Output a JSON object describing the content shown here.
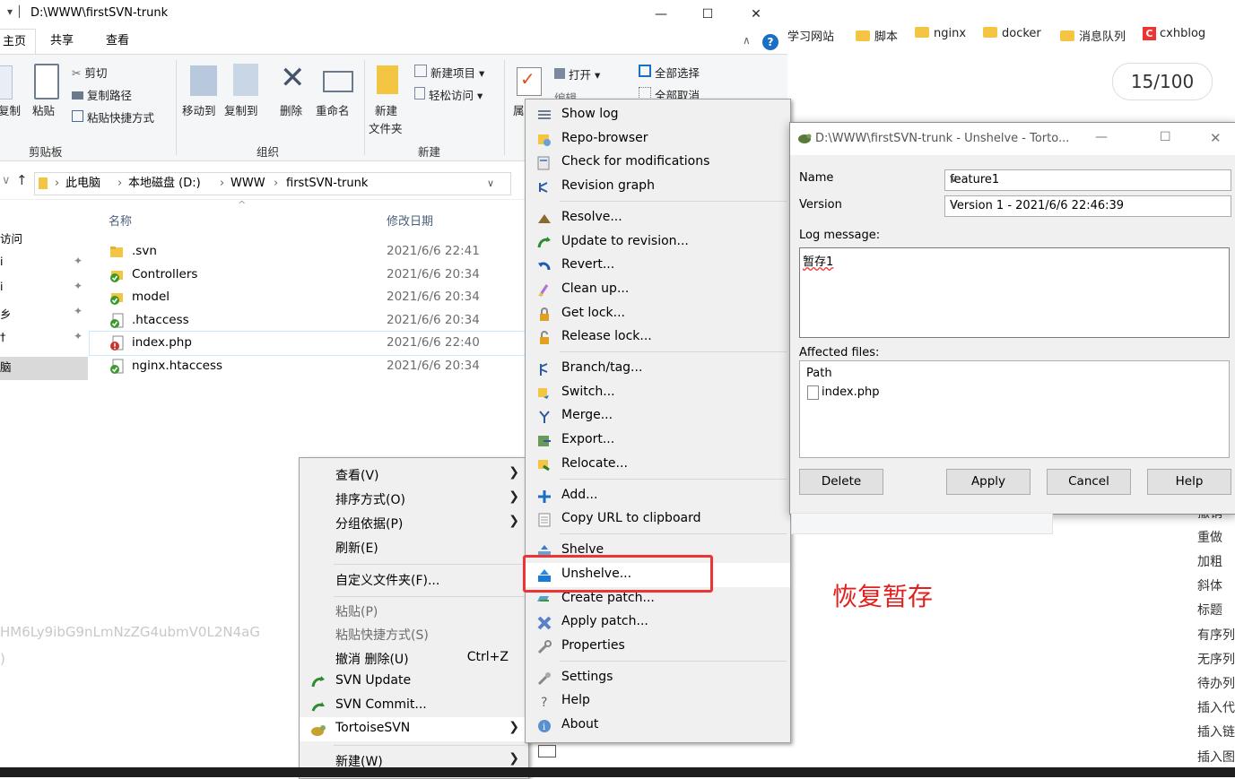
{
  "explorer": {
    "title_path": "D:\\WWW\\firstSVN-trunk",
    "tabs": [
      "主页",
      "共享",
      "查看"
    ],
    "ribbon": {
      "cut": "剪切",
      "copy_path": "复制路径",
      "paste_shortcut": "粘贴快捷方式",
      "copy": "复制",
      "paste": "粘贴",
      "group_clipboard": "剪贴板",
      "move_to": "移动到",
      "copy_to": "复制到",
      "delete": "删除",
      "rename": "重命名",
      "group_organize": "组织",
      "new_folder_1": "新建",
      "new_folder_2": "文件夹",
      "new_item": "新建项目 ▾",
      "easy_access": "轻松访问 ▾",
      "group_new": "新建",
      "open": "打开 ▾",
      "edit": "编辑",
      "select_all": "全部选择",
      "select_none": "全部取消",
      "props": "属"
    },
    "breadcrumb": [
      "此电脑",
      "本地磁盘 (D:)",
      "WWW",
      "firstSVN-trunk"
    ],
    "nav_items": [
      "访问",
      "i",
      "i",
      "乡",
      "†",
      "脑"
    ],
    "columns": {
      "name": "名称",
      "modified": "修改日期"
    },
    "files": [
      {
        "name": ".svn",
        "date": "2021/6/6 22:41",
        "icon": "folder-icon"
      },
      {
        "name": "Controllers",
        "date": "2021/6/6 20:34",
        "icon": "svn-ok-folder-icon"
      },
      {
        "name": "model",
        "date": "2021/6/6 20:34",
        "icon": "svn-ok-folder-icon"
      },
      {
        "name": ".htaccess",
        "date": "2021/6/6 20:34",
        "icon": "svn-ok-file-icon"
      },
      {
        "name": "index.php",
        "date": "2021/6/6 22:40",
        "icon": "svn-modified-file-icon"
      },
      {
        "name": "nginx.htaccess",
        "date": "2021/6/6 20:34",
        "icon": "svn-ok-file-icon"
      }
    ],
    "faded_text_1": "HM6Ly9ibG9nLmNzZG4ubmV0L2N4aG",
    "faded_text_2": ")"
  },
  "browser": {
    "bookmarks": [
      "学习网站",
      "脚本",
      "nginx",
      "docker",
      "消息队列",
      "cxhblog"
    ],
    "counter": "15/100",
    "side_words": [
      "撤销",
      "重做",
      "加粗",
      "斜体",
      "标题",
      "有序列",
      "无序列",
      "待办列",
      "插入代",
      "插入链",
      "插入图"
    ]
  },
  "main_menu": {
    "items": [
      {
        "label": "查看(V)",
        "arrow": true
      },
      {
        "label": "排序方式(O)",
        "arrow": true
      },
      {
        "label": "分组依据(P)",
        "arrow": true
      },
      {
        "label": "刷新(E)"
      },
      {
        "label": "自定义文件夹(F)..."
      },
      {
        "label": "粘贴(P)",
        "disabled": true
      },
      {
        "label": "粘贴快捷方式(S)",
        "disabled": true
      },
      {
        "label": "撤消 删除(U)",
        "shortcut": "Ctrl+Z"
      },
      {
        "label": "SVN Update"
      },
      {
        "label": "SVN Commit..."
      },
      {
        "label": "TortoiseSVN",
        "arrow": true
      },
      {
        "label": "新建(W)",
        "arrow": true
      }
    ]
  },
  "svn_menu": {
    "items": [
      "Show log",
      "Repo-browser",
      "Check for modifications",
      "Revision graph",
      "Resolve...",
      "Update to revision...",
      "Revert...",
      "Clean up...",
      "Get lock...",
      "Release lock...",
      "Branch/tag...",
      "Switch...",
      "Merge...",
      "Export...",
      "Relocate...",
      "Add...",
      "Copy URL to clipboard",
      "Shelve",
      "Unshelve...",
      "Create patch...",
      "Apply patch...",
      "Properties",
      "Settings",
      "Help",
      "About"
    ]
  },
  "dialog": {
    "title": "D:\\WWW\\firstSVN-trunk - Unshelve - Torto...",
    "name_label": "Name",
    "name_value": "feature1",
    "version_label": "Version",
    "version_value": "Version 1 - 2021/6/6 22:46:39",
    "log_label": "Log message:",
    "log_value": "暂存1",
    "affected_label": "Affected files:",
    "path_header": "Path",
    "files": [
      "index.php"
    ],
    "buttons": {
      "delete": "Delete",
      "apply": "Apply",
      "cancel": "Cancel",
      "help": "Help"
    }
  },
  "annotation": "恢复暂存",
  "colors": {
    "highlight_box": "#e33333",
    "annotation": "#e0211f",
    "svn_green": "#3a9a2a",
    "svn_red": "#d0312d"
  }
}
